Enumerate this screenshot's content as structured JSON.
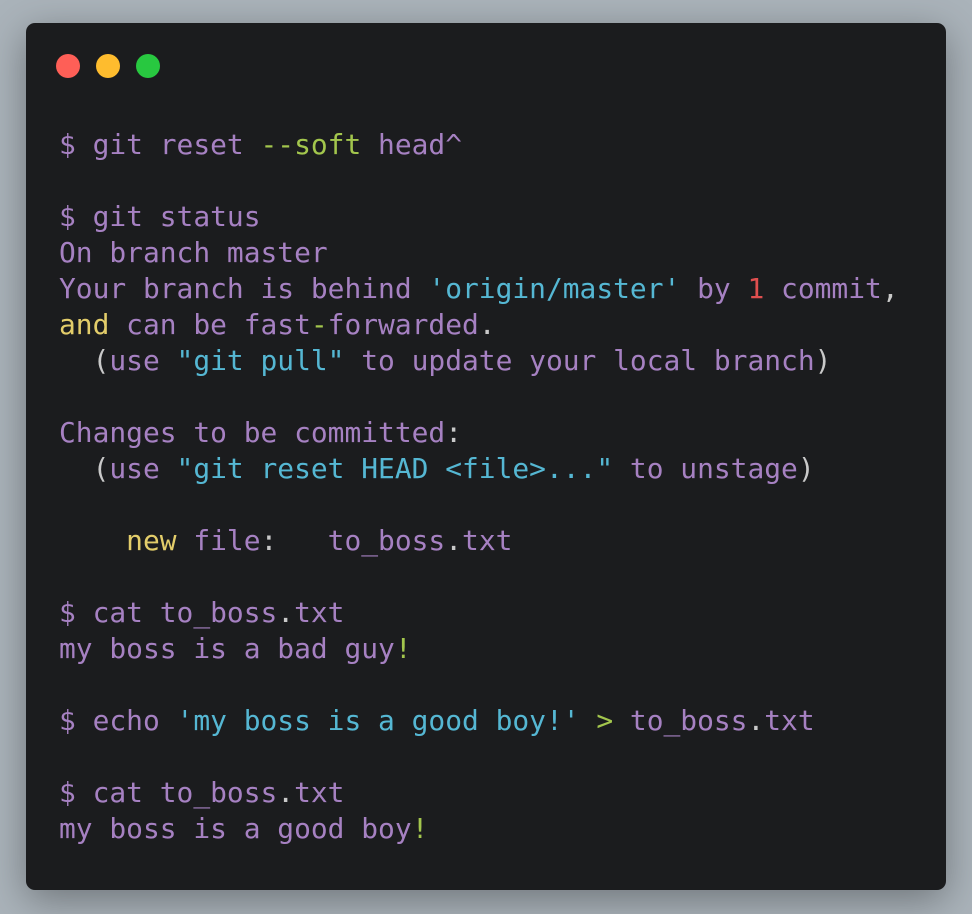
{
  "window": {
    "controls": [
      {
        "name": "close",
        "color": "#fe5f57"
      },
      {
        "name": "minimize",
        "color": "#febc2e"
      },
      {
        "name": "maximize",
        "color": "#28c840"
      }
    ]
  },
  "colors": {
    "background": "#1b1c1e",
    "purple": "#a681c2",
    "cyan": "#55b7d3",
    "green": "#a3c64d",
    "yellow": "#e3cd6a",
    "red": "#df4f4f",
    "white": "#c9c9c9"
  },
  "terminal": {
    "lines": [
      [
        [
          "$ git reset ",
          "purple"
        ],
        [
          "--soft",
          "green"
        ],
        [
          " head^",
          "purple"
        ]
      ],
      [],
      [
        [
          "$ git status",
          "purple"
        ]
      ],
      [
        [
          "On branch master",
          "purple"
        ]
      ],
      [
        [
          "Your branch is behind ",
          "purple"
        ],
        [
          "'origin/master'",
          "cyan"
        ],
        [
          " by ",
          "purple"
        ],
        [
          "1",
          "red"
        ],
        [
          " commit",
          "purple"
        ],
        [
          ",",
          "white"
        ]
      ],
      [
        [
          "and",
          "yellow"
        ],
        [
          " can be fast",
          "purple"
        ],
        [
          "-",
          "green"
        ],
        [
          "forwarded",
          "purple"
        ],
        [
          ".",
          "white"
        ]
      ],
      [
        [
          "  (",
          "white"
        ],
        [
          "use ",
          "purple"
        ],
        [
          "\"git pull\"",
          "cyan"
        ],
        [
          " to update your local branch",
          "purple"
        ],
        [
          ")",
          "white"
        ]
      ],
      [],
      [
        [
          "Changes to be committed",
          "purple"
        ],
        [
          ":",
          "white"
        ]
      ],
      [
        [
          "  (",
          "white"
        ],
        [
          "use ",
          "purple"
        ],
        [
          "\"git reset HEAD <file>...\"",
          "cyan"
        ],
        [
          " to unstage",
          "purple"
        ],
        [
          ")",
          "white"
        ]
      ],
      [],
      [
        [
          "    new",
          "yellow"
        ],
        [
          " file",
          "purple"
        ],
        [
          ":",
          "white"
        ],
        [
          "   to_boss",
          "purple"
        ],
        [
          ".",
          "white"
        ],
        [
          "txt",
          "purple"
        ]
      ],
      [],
      [
        [
          "$ cat to_boss",
          "purple"
        ],
        [
          ".",
          "white"
        ],
        [
          "txt",
          "purple"
        ]
      ],
      [
        [
          "my boss is a bad guy",
          "purple"
        ],
        [
          "!",
          "green"
        ]
      ],
      [],
      [
        [
          "$ echo ",
          "purple"
        ],
        [
          "'my boss is a good boy!'",
          "cyan"
        ],
        [
          " > ",
          "green"
        ],
        [
          "to_boss",
          "purple"
        ],
        [
          ".",
          "white"
        ],
        [
          "txt",
          "purple"
        ]
      ],
      [],
      [
        [
          "$ cat to_boss",
          "purple"
        ],
        [
          ".",
          "white"
        ],
        [
          "txt",
          "purple"
        ]
      ],
      [
        [
          "my boss is a good boy",
          "purple"
        ],
        [
          "!",
          "green"
        ]
      ]
    ]
  }
}
